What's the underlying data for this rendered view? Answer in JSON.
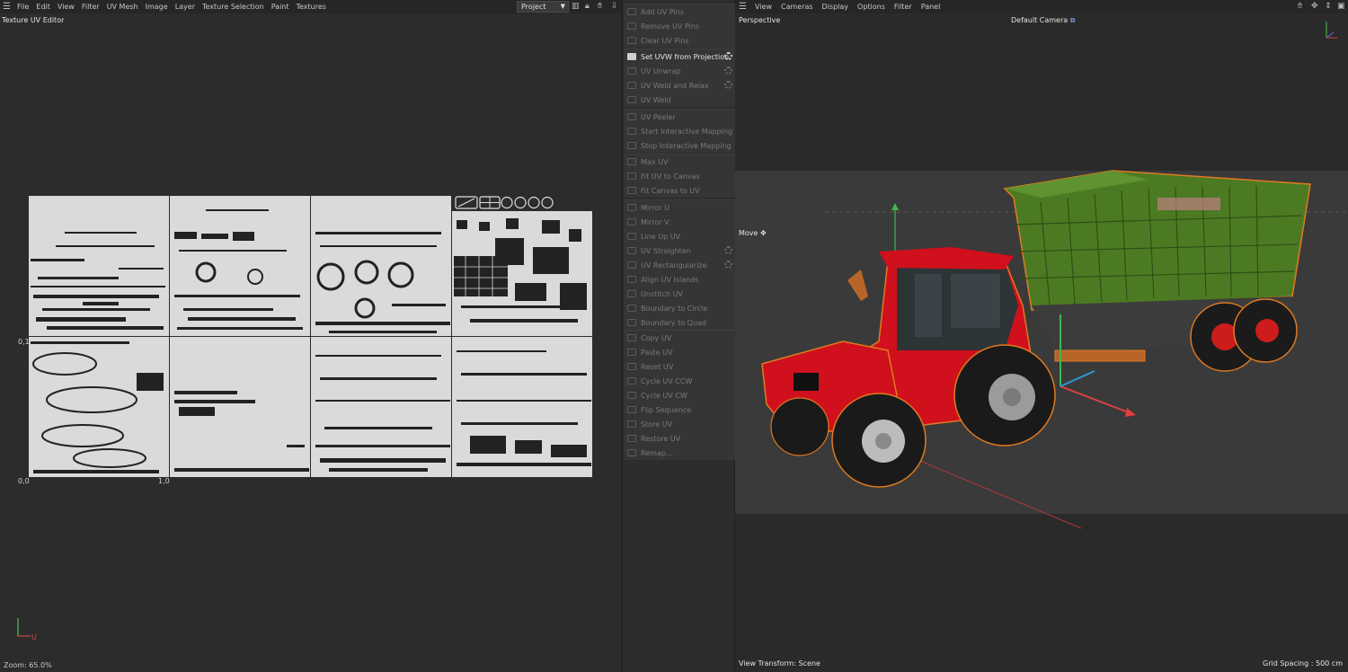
{
  "uv_editor": {
    "menu": [
      "File",
      "Edit",
      "View",
      "Filter",
      "UV Mesh",
      "Image",
      "Layer",
      "Texture Selection",
      "Paint",
      "Textures"
    ],
    "project_dropdown": "Project",
    "title": "Texture UV Editor",
    "labels": {
      "v_one": "0,1",
      "origin": "0,0",
      "u_one": "1,0"
    },
    "axis": {
      "u": "U"
    },
    "zoom": "Zoom: 65.0%"
  },
  "commands": {
    "groups": [
      [
        "Add UV Pins",
        "Remove UV Pins",
        "Clear UV Pins"
      ],
      [
        "Set UVW from Projection",
        "UV Unwrap",
        "UV Weld and Relax",
        "UV Weld"
      ],
      [
        "UV Peeler",
        "Start Interactive Mapping",
        "Stop Interactive Mapping"
      ],
      [
        "Max UV",
        "Fit UV to Canvas",
        "Fit Canvas to UV"
      ],
      [
        "Mirror U",
        "Mirror V",
        "Line Up UV",
        "UV Straighten",
        "UV Rectangularize",
        "Align UV Islands",
        "Unstitch UV",
        "Boundary to Circle",
        "Boundary to Quad"
      ],
      [
        "Copy UV",
        "Paste UV",
        "Reset UV",
        "Cycle UV CCW",
        "Cycle UV CW",
        "Flip Sequence",
        "Store UV",
        "Restore UV",
        "Remap..."
      ]
    ],
    "active": "Set UVW from Projection",
    "with_settings": [
      "Set UVW from Projection",
      "UV Unwrap",
      "UV Weld and Relax",
      "UV Straighten",
      "UV Rectangularize"
    ]
  },
  "viewport": {
    "menu": [
      "View",
      "Cameras",
      "Display",
      "Options",
      "Filter",
      "Panel"
    ],
    "mode": "Perspective",
    "camera": "Default Camera",
    "tool": "Move",
    "view_transform": "View Transform: Scene",
    "grid_spacing": "Grid Spacing : 500 cm",
    "colors": {
      "tractor": "#d0101c",
      "trailer": "#4c7a22",
      "selection": "#e07a20"
    }
  }
}
